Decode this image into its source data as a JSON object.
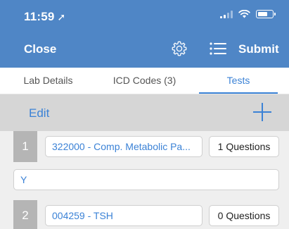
{
  "status_bar": {
    "time": "11:59",
    "location_glyph": "➚"
  },
  "nav": {
    "close_label": "Close",
    "submit_label": "Submit",
    "icons": {
      "settings": "gear-icon",
      "list": "list-icon"
    }
  },
  "tabs": [
    {
      "label": "Lab Details",
      "active": false
    },
    {
      "label": "ICD Codes (3)",
      "active": false
    },
    {
      "label": "Tests",
      "active": true
    }
  ],
  "edit_bar": {
    "edit_label": "Edit",
    "add_icon": "plus-icon"
  },
  "tests": [
    {
      "number": "1",
      "name": "322000 - Comp. Metabolic Pa...",
      "questions": "1 Questions",
      "answer": "Y"
    },
    {
      "number": "2",
      "name": "004259 - TSH",
      "questions": "0 Questions"
    }
  ],
  "colors": {
    "header_blue": "#4f86c6",
    "accent_blue": "#3b82d6",
    "edit_bar_gray": "#d6d6d6",
    "row_gray": "#efefef",
    "number_gray": "#b5b5b5"
  }
}
